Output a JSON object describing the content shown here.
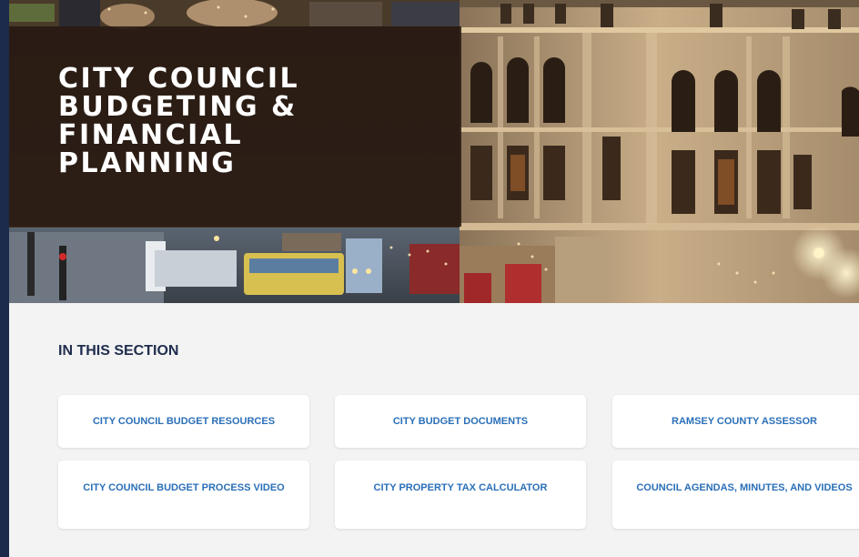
{
  "hero": {
    "title": "CITY COUNCIL\nBUDGETING &\nFINANCIAL\nPLANNING"
  },
  "section": {
    "heading": "IN THIS SECTION",
    "links": [
      {
        "label": "CITY COUNCIL BUDGET RESOURCES"
      },
      {
        "label": "CITY BUDGET DOCUMENTS"
      },
      {
        "label": "RAMSEY COUNTY ASSESSOR"
      },
      {
        "label": "CITY COUNCIL BUDGET PROCESS VIDEO"
      },
      {
        "label": "CITY PROPERTY TAX CALCULATOR"
      },
      {
        "label": "COUNCIL AGENDAS, MINUTES, AND VIDEOS"
      }
    ]
  },
  "colors": {
    "accent": "#2a6fb8",
    "heading": "#1f2d4d",
    "background": "#f3f3f4",
    "title_box": "#2a1c14"
  }
}
